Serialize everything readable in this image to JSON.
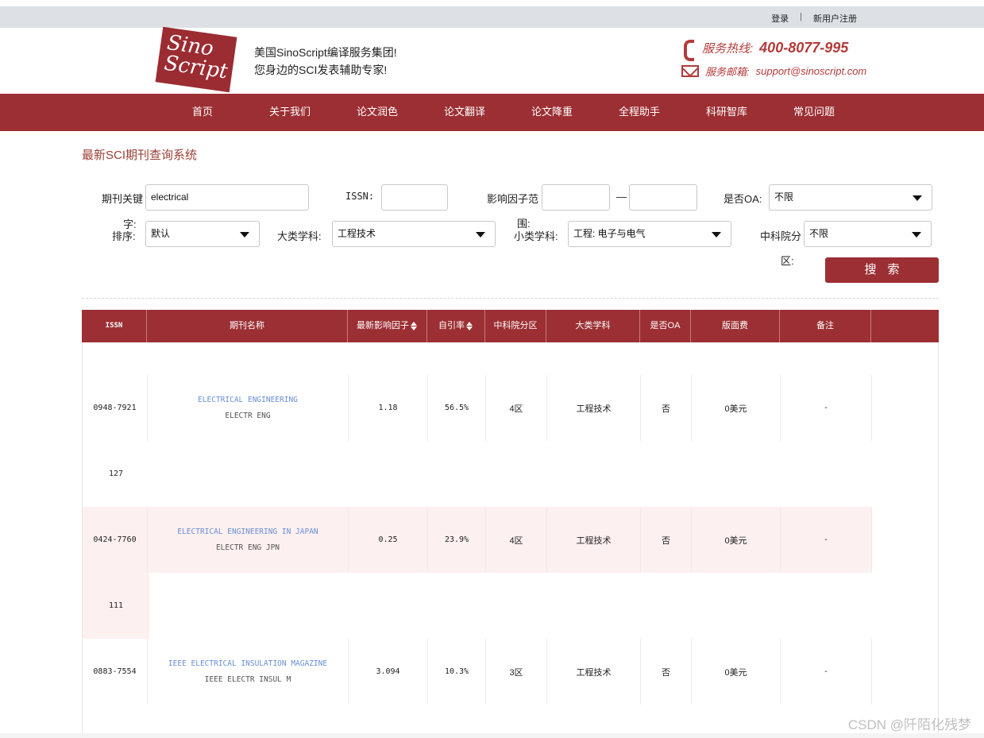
{
  "topbar": {
    "login": "登录",
    "separator": "|",
    "register": "新用户注册"
  },
  "header": {
    "logo_line1": "Sino",
    "logo_line2": "Script",
    "slogan_line1": "美国SinoScript编译服务集团!",
    "slogan_line2": "您身边的SCI发表辅助专家!",
    "hotline_label": "服务热线:",
    "hotline_number": "400-8077-995",
    "email_label": "服务邮箱:",
    "email": "support@sinoscript.com"
  },
  "nav": {
    "items": [
      "首页",
      "关于我们",
      "论文润色",
      "论文翻译",
      "论文降重",
      "全程助手",
      "科研智库",
      "常见问题"
    ]
  },
  "page_title": "最新SCI期刊查询系统",
  "form": {
    "keyword_label_1": "期刊关键",
    "keyword_label_2": "字:",
    "keyword_value": "electrical",
    "issn_label": "ISSN:",
    "issn_value": "",
    "if_label_1": "影响因子范",
    "if_label_2": "围:",
    "if_dash": "—",
    "if_min": "",
    "if_max": "",
    "oa_label": "是否OA:",
    "oa_value": "不限",
    "sort_label": "排序:",
    "sort_value": "默认",
    "major_label": "大类学科:",
    "major_value": "工程技术",
    "minor_label": "小类学科:",
    "minor_value": "工程: 电子与电气",
    "zone_label_1": "中科院分",
    "zone_label_2": "区:",
    "zone_value": "不限",
    "search_button": "搜索"
  },
  "table": {
    "headers": [
      "ISSN",
      "期刊名称",
      "最新影响因子",
      "自引率",
      "中科院分区",
      "大类学科",
      "是否OA",
      "版面费",
      "备注"
    ],
    "rows": [
      {
        "issn": "0948-7921",
        "name": "ELECTRICAL ENGINEERING",
        "abbr": "ELECTR ENG",
        "if": "1.18",
        "self": "56.5%",
        "zone": "4区",
        "major": "工程技术",
        "oa": "否",
        "fee": "0美元",
        "note": "-",
        "extra": "127"
      },
      {
        "issn": "0424-7760",
        "name": "ELECTRICAL ENGINEERING IN JAPAN",
        "abbr": "ELECTR ENG JPN",
        "if": "0.25",
        "self": "23.9%",
        "zone": "4区",
        "major": "工程技术",
        "oa": "否",
        "fee": "0美元",
        "note": "-",
        "extra": "111"
      },
      {
        "issn": "0883-7554",
        "name": "IEEE ELECTRICAL INSULATION MAGAZINE",
        "abbr": "IEEE ELECTR INSUL M",
        "if": "3.094",
        "self": "10.3%",
        "zone": "3区",
        "major": "工程技术",
        "oa": "否",
        "fee": "0美元",
        "note": "-",
        "extra": ""
      }
    ]
  },
  "watermark": "CSDN @阡陌化残梦",
  "colors": {
    "brand": "#9c2f33",
    "link": "#6a8fd4",
    "pink_row": "#fdf0f0"
  }
}
